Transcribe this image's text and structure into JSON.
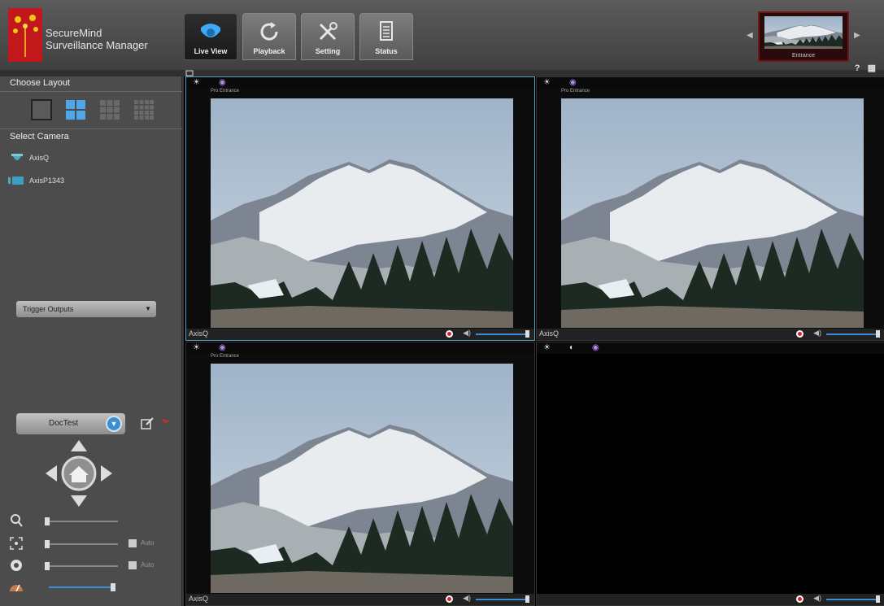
{
  "header": {
    "brand_line1": "SecureMind",
    "brand_line2": "Surveillance Manager",
    "tabs": [
      {
        "label": "Live View",
        "icon": "camera-icon",
        "active": true
      },
      {
        "label": "Playback",
        "icon": "refresh-icon",
        "active": false
      },
      {
        "label": "Setting",
        "icon": "tools-icon",
        "active": false
      },
      {
        "label": "Status",
        "icon": "document-icon",
        "active": false
      }
    ],
    "thumbnail_caption": "Entrance",
    "help_label": "?"
  },
  "sidebar": {
    "choose_layout": "Choose Layout",
    "select_camera": "Select Camera",
    "cameras": [
      {
        "name": "AxisQ",
        "icon": "dome-camera-icon"
      },
      {
        "name": "AxisP1343",
        "icon": "box-camera-icon"
      }
    ],
    "trigger_outputs": "Trigger Outputs",
    "preset": "DocTest",
    "auto_label": "Auto"
  },
  "panes": [
    {
      "name": "AxisQ",
      "caption": "Pro Entrance",
      "has_video": true,
      "selected": true
    },
    {
      "name": "AxisQ",
      "caption": "Pro Entrance",
      "has_video": true,
      "selected": false
    },
    {
      "name": "AxisQ",
      "caption": "Pro Entrance",
      "has_video": true,
      "selected": false
    },
    {
      "name": "",
      "caption": "",
      "has_video": false,
      "selected": false
    }
  ],
  "colors": {
    "accent": "#3a8fd6",
    "logo": "#c0181b"
  }
}
